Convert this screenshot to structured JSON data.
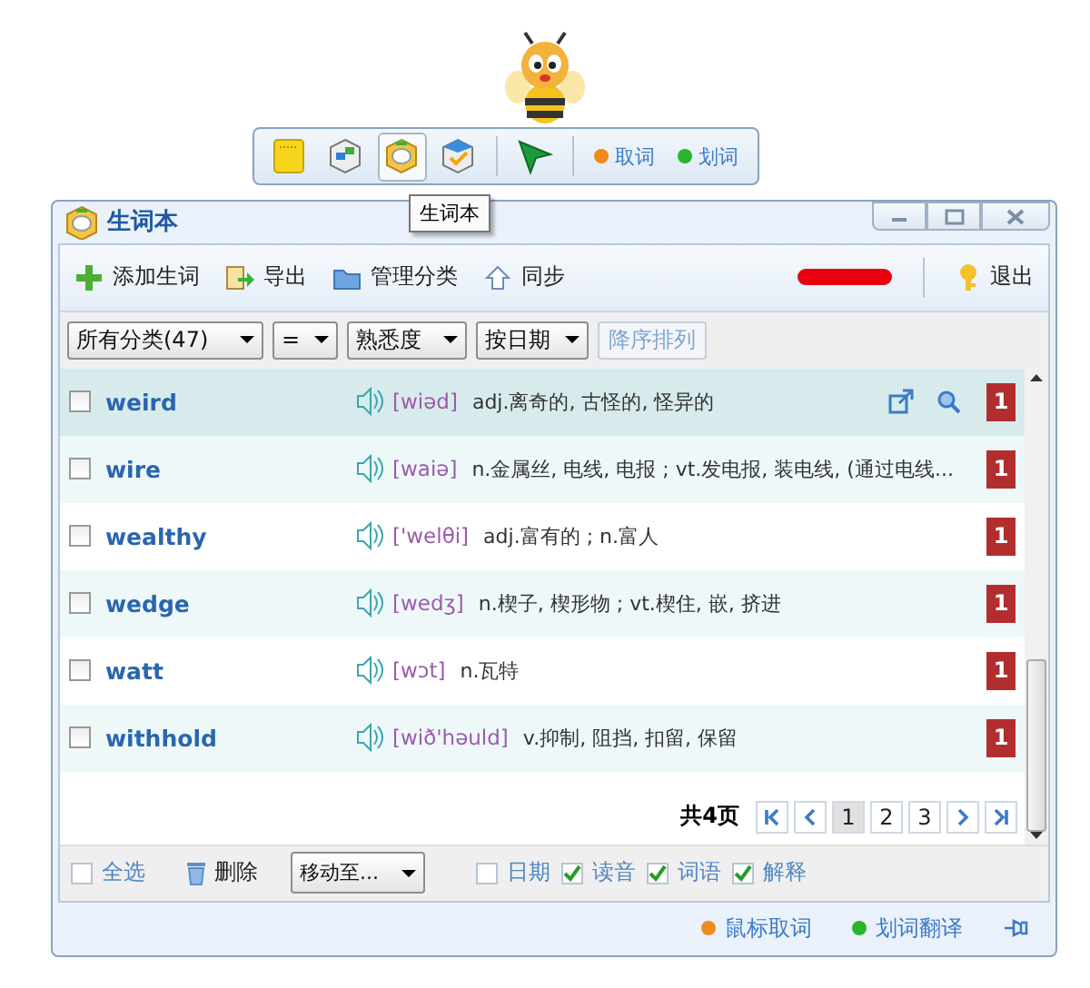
{
  "floating_toolbar": {
    "tools": [
      {
        "kind": "note",
        "selected": false
      },
      {
        "kind": "translate",
        "selected": false
      },
      {
        "kind": "wordbook",
        "selected": true
      },
      {
        "kind": "check",
        "selected": false
      },
      {
        "kind": "pointer",
        "selected": false
      }
    ],
    "toggles": [
      {
        "label": "取词",
        "color": "#f08a1c"
      },
      {
        "label": "划词",
        "color": "#2bb52b"
      }
    ],
    "tooltip": "生词本"
  },
  "window": {
    "title": "生词本"
  },
  "toolbar": {
    "actions": [
      {
        "kind": "add",
        "label": "添加生词"
      },
      {
        "kind": "export",
        "label": "导出"
      },
      {
        "kind": "folder",
        "label": "管理分类"
      },
      {
        "kind": "sync",
        "label": "同步"
      }
    ],
    "logout": "退出"
  },
  "filters": {
    "dropdowns": [
      "所有分类(47)",
      "=",
      "熟悉度",
      "按日期"
    ],
    "sort_button": "降序排列"
  },
  "words": [
    {
      "word": "weird",
      "phonetic": "[wiəd]",
      "meaning": "adj.离奇的, 古怪的, 怪异的",
      "level": "1",
      "checked": false,
      "selected": true
    },
    {
      "word": "wire",
      "phonetic": "[waiə]",
      "meaning": "n.金属丝, 电线, 电报 ; vt.发电报, 装电线, (通过电线...",
      "level": "1",
      "checked": false,
      "selected": false
    },
    {
      "word": "wealthy",
      "phonetic": "['welθi]",
      "meaning": "adj.富有的 ; n.富人",
      "level": "1",
      "checked": false,
      "selected": false
    },
    {
      "word": "wedge",
      "phonetic": "[wedʒ]",
      "meaning": "n.楔子, 楔形物 ; vt.楔住, 嵌, 挤进",
      "level": "1",
      "checked": false,
      "selected": false
    },
    {
      "word": "watt",
      "phonetic": "[wɔt]",
      "meaning": "n.瓦特",
      "level": "1",
      "checked": false,
      "selected": false
    },
    {
      "word": "withhold",
      "phonetic": "[wið'həuld]",
      "meaning": "v.抑制, 阻挡, 扣留, 保留",
      "level": "1",
      "checked": false,
      "selected": false
    }
  ],
  "pagination": {
    "total": "共4页",
    "pages": [
      {
        "label": "1",
        "selected": true
      },
      {
        "label": "2",
        "selected": false
      },
      {
        "label": "3",
        "selected": false
      }
    ]
  },
  "bottom_bar": {
    "select_all": {
      "label": "全选",
      "checked": false
    },
    "delete": "删除",
    "move_to": "移动至...",
    "columns": [
      {
        "label": "日期",
        "checked": false
      },
      {
        "label": "读音",
        "checked": true
      },
      {
        "label": "词语",
        "checked": true
      },
      {
        "label": "解释",
        "checked": true
      }
    ]
  },
  "status_bar": [
    {
      "label": "鼠标取词",
      "color": "#f08a1c"
    },
    {
      "label": "划词翻译",
      "color": "#2bb52b"
    }
  ]
}
